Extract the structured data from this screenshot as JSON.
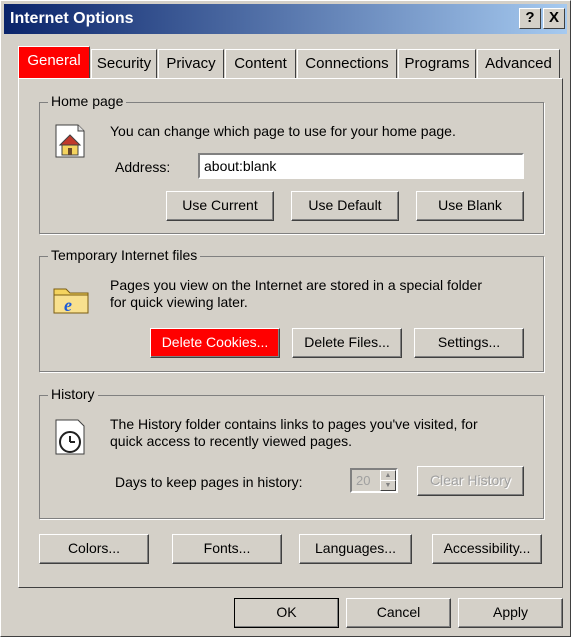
{
  "window": {
    "title": "Internet Options",
    "help_label": "?",
    "close_label": "X"
  },
  "tabs": [
    {
      "label": "General"
    },
    {
      "label": "Security"
    },
    {
      "label": "Privacy"
    },
    {
      "label": "Content"
    },
    {
      "label": "Connections"
    },
    {
      "label": "Programs"
    },
    {
      "label": "Advanced"
    }
  ],
  "home_page": {
    "group_label": "Home page",
    "description": "You can change which page to use for your home page.",
    "address_label": "Address:",
    "address_value": "about:blank",
    "use_current": "Use Current",
    "use_default": "Use Default",
    "use_blank": "Use Blank"
  },
  "temp_files": {
    "group_label": "Temporary Internet files",
    "description_line1": "Pages you view on the Internet are stored in a special folder",
    "description_line2": "for quick viewing later.",
    "delete_cookies": "Delete Cookies...",
    "delete_files": "Delete Files...",
    "settings": "Settings..."
  },
  "history": {
    "group_label": "History",
    "description_line1": "The History folder contains links to pages you've visited, for",
    "description_line2": "quick access to recently viewed pages.",
    "days_label": "Days to keep pages in history:",
    "days_value": "20",
    "clear_history": "Clear History"
  },
  "bottom_buttons": {
    "colors": "Colors...",
    "fonts": "Fonts...",
    "languages": "Languages...",
    "accessibility": "Accessibility..."
  },
  "dialog_buttons": {
    "ok": "OK",
    "cancel": "Cancel",
    "apply": "Apply"
  },
  "colors": {
    "highlight": "#ff0000",
    "face": "#d4d0c8",
    "title_start": "#0a246a",
    "title_end": "#a6caf0"
  },
  "icons": {
    "home": "home-page-icon",
    "temp_files": "ie-folder-icon",
    "history": "history-clock-icon"
  }
}
